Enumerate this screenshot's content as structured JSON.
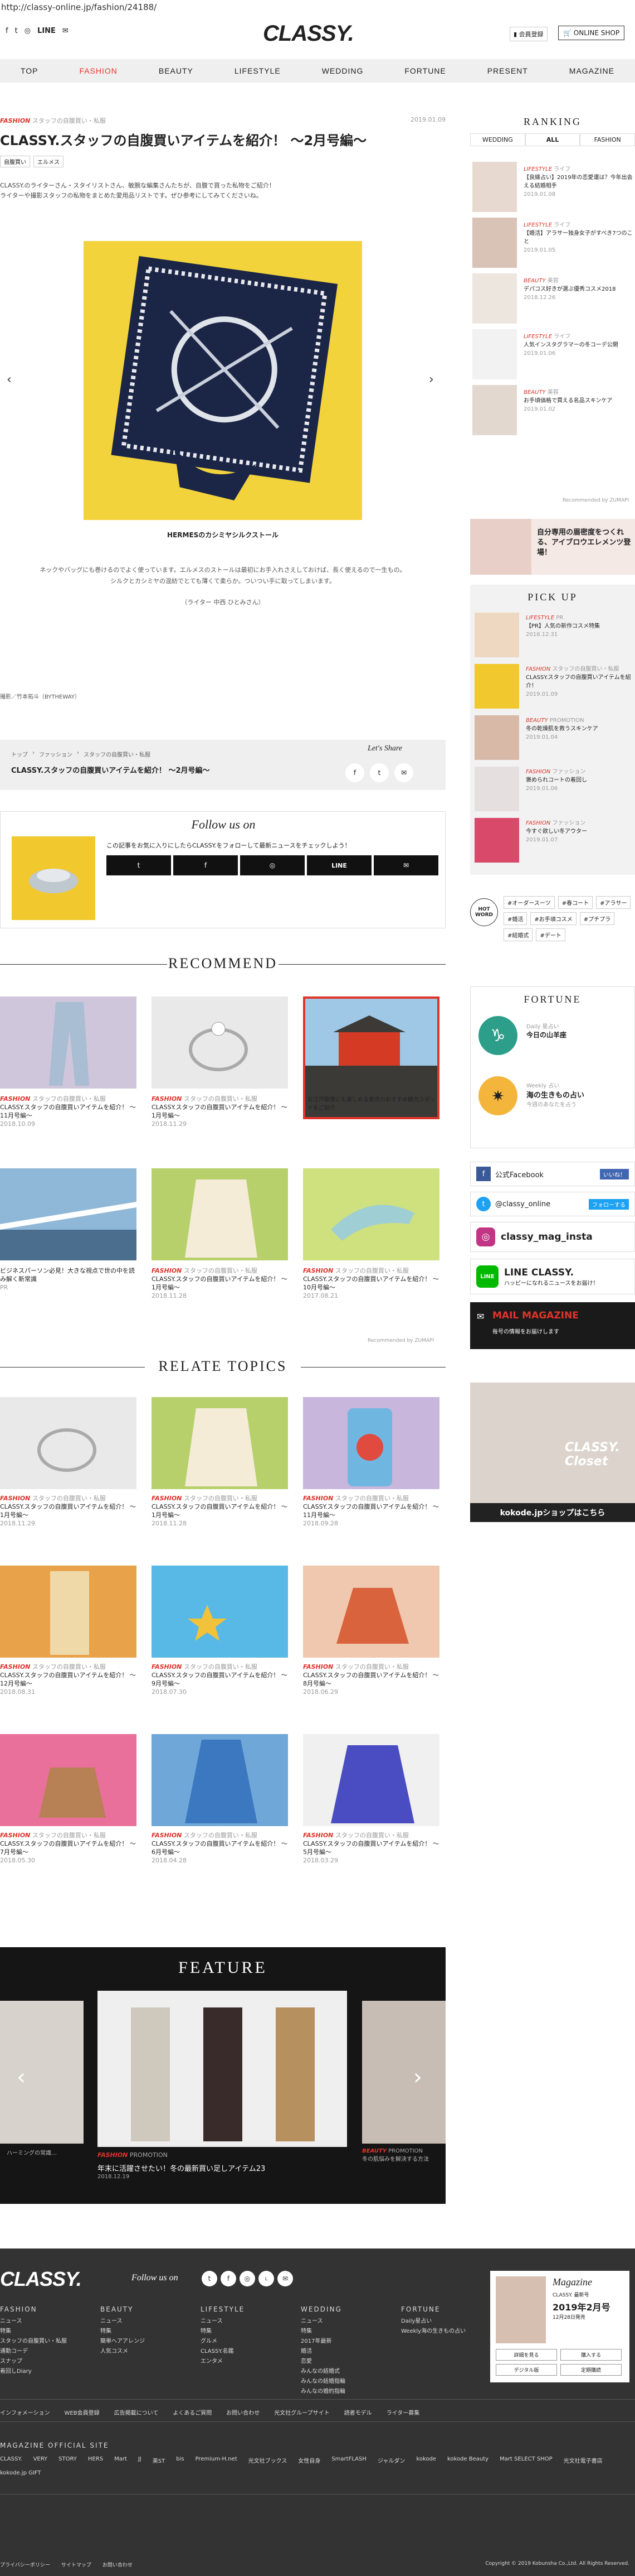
{
  "url": "http://classy-online.jp/fashion/24188/",
  "header": {
    "brand": "CLASSY.",
    "social": [
      "f",
      "t",
      "i",
      "LINE",
      "mail"
    ],
    "mypage": "会員登録",
    "online_shop": "ONLINE SHOP"
  },
  "nav": [
    "TOP",
    "FASHION",
    "BEAUTY",
    "LIFESTYLE",
    "WEDDING",
    "FORTUNE",
    "PRESENT",
    "MAGAZINE"
  ],
  "article": {
    "category": "FASHION",
    "subcat": "スタッフの自腹買い・私服",
    "date": "2019.01.09",
    "title": "CLASSY.スタッフの自腹買いアイテムを紹介！ ～2月号編～",
    "tags": [
      "自腹買い",
      "エルメス"
    ],
    "intro1": "CLASSY.のライターさん・スタイリストさん、敏腕な編集さんたちが、自腹で買った私物をご紹介！",
    "intro2": "ライターや撮影スタッフの私物をまとめた愛用品リストです。ぜひ参考にしてみてくださいね。",
    "photo_caption": "HERMESのカシミヤシルクストール",
    "body1": "ネックやバッグにも巻けるのでよく使っています。エルメスのストールは最初にお手入れさえしておけば、長く使えるので一生もの。",
    "body2": "シルクとカシミヤの混紡でとても薄くて柔らか。ついつい手に取ってしまいます。",
    "body3": "（ライター 中西 ひとみさん）",
    "credit": "撮影／竹本拓斗（BYTHEWAY）",
    "breadcrumb": [
      "トップ",
      "ファッション",
      "スタッフの自腹買い・私服"
    ],
    "breadcrumb_title": "CLASSY.スタッフの自腹買いアイテムを紹介！ ～2月号編～",
    "share": "Let's Share"
  },
  "follow": {
    "title": "Follow us on",
    "text": "この記事をお気に入りにしたらCLASSY.をフォローして最新ニュースをチェックしよう！",
    "buttons": [
      "Twitter",
      "Facebook",
      "Instagram",
      "LINE",
      "Mail"
    ]
  },
  "recommend": {
    "title": "RECOMMEND",
    "items": [
      {
        "cat": "FASHION",
        "sub": "スタッフの自腹買い・私服",
        "title": "CLASSY.スタッフの自腹買いアイテムを紹介！ ～11月号編～",
        "date": "2018.10.09"
      },
      {
        "cat": "FASHION",
        "sub": "スタッフの自腹買い・私服",
        "title": "CLASSY.スタッフの自腹買いアイテムを紹介！ ～1月号編～",
        "date": "2018.11.29"
      },
      {
        "cat": "",
        "sub": "",
        "title": "お江戸散策にも楽しめる東京のおすすめ観光スポットをご紹介",
        "date": ""
      },
      {
        "cat": "",
        "sub": "",
        "title": "ビジネスパーソン必見！大きな視点で世の中を読み解く新常識",
        "date": "PR"
      },
      {
        "cat": "FASHION",
        "sub": "スタッフの自腹買い・私服",
        "title": "CLASSY.スタッフの自腹買いアイテムを紹介！ ～1月号編～",
        "date": "2018.11.28"
      },
      {
        "cat": "FASHION",
        "sub": "スタッフの自腹買い・私服",
        "title": "CLASSY.スタッフの自腹買いアイテムを紹介！ ～10月号編～",
        "date": "2017.08.21"
      }
    ],
    "powered": "Recommended by ZUMAPI"
  },
  "relate": {
    "title": "RELATE TOPICS",
    "items": [
      {
        "cat": "FASHION",
        "sub": "スタッフの自腹買い・私服",
        "title": "CLASSY.スタッフの自腹買いアイテムを紹介！ ～1月号編～",
        "date": "2018.11.29"
      },
      {
        "cat": "FASHION",
        "sub": "スタッフの自腹買い・私服",
        "title": "CLASSY.スタッフの自腹買いアイテムを紹介！ ～1月号編～",
        "date": "2018.11.28"
      },
      {
        "cat": "FASHION",
        "sub": "スタッフの自腹買い・私服",
        "title": "CLASSY.スタッフの自腹買いアイテムを紹介！ ～11月号編～",
        "date": "2018.09.28"
      },
      {
        "cat": "FASHION",
        "sub": "スタッフの自腹買い・私服",
        "title": "CLASSY.スタッフの自腹買いアイテムを紹介！ ～12月号編～",
        "date": "2018.08.31"
      },
      {
        "cat": "FASHION",
        "sub": "スタッフの自腹買い・私服",
        "title": "CLASSY.スタッフの自腹買いアイテムを紹介！ ～9月号編～",
        "date": "2018.07.30"
      },
      {
        "cat": "FASHION",
        "sub": "スタッフの自腹買い・私服",
        "title": "CLASSY.スタッフの自腹買いアイテムを紹介！ ～8月号編～",
        "date": "2018.06.29"
      },
      {
        "cat": "FASHION",
        "sub": "スタッフの自腹買い・私服",
        "title": "CLASSY.スタッフの自腹買いアイテムを紹介！ ～7月号編～",
        "date": "2018.05.30"
      },
      {
        "cat": "FASHION",
        "sub": "スタッフの自腹買い・私服",
        "title": "CLASSY.スタッフの自腹買いアイテムを紹介！ ～6月号編～",
        "date": "2018.04.28"
      },
      {
        "cat": "FASHION",
        "sub": "スタッフの自腹買い・私服",
        "title": "CLASSY.スタッフの自腹買いアイテムを紹介！ ～5月号編～",
        "date": "2018.03.29"
      }
    ]
  },
  "feature": {
    "title": "FEATURE",
    "cat": "FASHION",
    "sub": "PROMOTION",
    "text": "年末に活躍させたい！冬の最新買い足しアイテム23",
    "date": "2018.12.19",
    "left_caption": "ハーミングの常識…",
    "right_cat": "BEAUTY",
    "right_sub": "PROMOTION",
    "right_text": "冬の肌悩みを解決する方法"
  },
  "sidebar": {
    "ranking_title": "RANKING",
    "ranking_tabs": [
      "WEDDING",
      "ALL",
      "FASHION"
    ],
    "ranking": [
      {
        "cat": "LIFESTYLE",
        "sub": "ライフ",
        "title": "【良縁占い】2019年の恋愛運は？今年出会える結婚相手",
        "date": "2019.01.08"
      },
      {
        "cat": "LIFESTYLE",
        "sub": "ライフ",
        "title": "【婚活】アラサー独身女子がすべき7つのこと",
        "date": "2019.01.05"
      },
      {
        "cat": "BEAUTY",
        "sub": "美容",
        "title": "デパコス好きが選ぶ優秀コスメ2018",
        "date": "2018.12.26"
      },
      {
        "cat": "LIFESTYLE",
        "sub": "ライフ",
        "title": "人気インスタグラマーの冬コーデ公開",
        "date": "2019.01.06"
      },
      {
        "cat": "BEAUTY",
        "sub": "美容",
        "title": "お手頃価格で買える名品スキンケア",
        "date": "2019.01.02"
      }
    ],
    "ranking_powered": "Recommended by ZUMAPI",
    "ad_banner": "自分専用の眉密度をつくれる、アイブロウエレメンツ登場！",
    "pickup_title": "PICK UP",
    "pickup": [
      {
        "cat": "LIFESTYLE",
        "sub": "PR",
        "title": "【PR】人気の新作コスメ特集",
        "date": "2018.12.31"
      },
      {
        "cat": "FASHION",
        "sub": "スタッフの自腹買い・私服",
        "title": "CLASSY.スタッフの自腹買いアイテムを紹介！",
        "date": "2019.01.09"
      },
      {
        "cat": "BEAUTY",
        "sub": "PROMOTION",
        "title": "冬の乾燥肌を救うスキンケア",
        "date": "2019.01.04"
      },
      {
        "cat": "FASHION",
        "sub": "ファッション",
        "title": "褒められコートの着回し",
        "date": "2019.01.06"
      },
      {
        "cat": "FASHION",
        "sub": "ファッション",
        "title": "今すぐ欲しい冬アウター",
        "date": "2019.01.07"
      }
    ],
    "hotword_label": "HOT WORD",
    "hotwords": [
      "#オーダースーツ",
      "#春コート",
      "#アラサー",
      "#婚活",
      "#お手頃コスメ",
      "#プチプラ",
      "#結婚式",
      "#デート"
    ],
    "fortune_title": "FORTUNE",
    "fortune1_label": "Daily 星占い",
    "fortune1_text": "今日の山羊座",
    "fortune2_label": "Weekly 占い",
    "fortune2_text": "海の生きもの占い",
    "fortune2_sub": "今週のあなたを占う",
    "fb": "公式Facebook",
    "fb_like": "いいね！",
    "tw": "@classy_online",
    "tw_follow": "フォローする",
    "insta": "classy_mag_insta",
    "line": "LINE CLASSY.",
    "line_sub": "ハッピーになれるニュースをお届け！",
    "mail_title": "MAIL MAGAZINE",
    "mail_sub": "毎号の情報をお届けします",
    "closet": "CLASSY. Closet",
    "kokode": "kokode.jpショップはこちら"
  },
  "footer": {
    "brand": "CLASSY.",
    "follow": "Follow us on",
    "cols": [
      {
        "h": "FASHION",
        "items": [
          "ニュース",
          "特集",
          "スタッフの自腹買い・私服",
          "通勤コーデ",
          "スナップ",
          "着回しDiary"
        ]
      },
      {
        "h": "BEAUTY",
        "items": [
          "ニュース",
          "特集",
          "簡単ヘアアレンジ",
          "人気コスメ"
        ]
      },
      {
        "h": "LIFESTYLE",
        "items": [
          "ニュース",
          "特集",
          "グルメ",
          "CLASSY.名鑑",
          "エンタメ"
        ]
      },
      {
        "h": "WEDDING",
        "items": [
          "ニュース",
          "特集",
          "2017年最新",
          "婚活",
          "恋愛",
          "みんなの結婚式",
          "みんなの結婚指輪",
          "みんなの婚約指輪"
        ]
      },
      {
        "h": "FORTUNE",
        "items": [
          "Daily星占い",
          "Weekly海の生きもの占い"
        ]
      }
    ],
    "mag_title": "Magazine",
    "mag_sub": "CLASSY. 最新号",
    "mag_date": "2019年2月号",
    "mag_note": "12月28日発売",
    "mag_btns": [
      "詳細を見る",
      "購入する",
      "デジタル版",
      "定期購読"
    ],
    "links": [
      "インフォメーション",
      "WEB会員登録",
      "広告掲載について",
      "よくあるご質問",
      "お問い合わせ",
      "光文社グループサイト",
      "読者モデル",
      "ライター募集"
    ],
    "official_title": "MAGAZINE OFFICIAL SITE",
    "official": [
      "CLASSY.",
      "VERY",
      "STORY",
      "HERS",
      "Mart",
      "JJ",
      "美ST",
      "bis",
      "Premium-H.net",
      "光文社ブックス",
      "女性自身",
      "SmartFLASH",
      "ジャルダン",
      "kokode",
      "kokode Beauty",
      "Mart SELECT SHOP",
      "光文社電子書店",
      "kokode.jp GIFT"
    ],
    "privacy": [
      "プライバシーポリシー",
      "サイトマップ",
      "お問い合わせ"
    ],
    "copyright": "Copyright © 2019 Kobunsha Co.,Ltd. All Rights Reserved."
  },
  "colors": {
    "accent": "#e0342b",
    "footer": "#333333",
    "feature": "#151515"
  }
}
